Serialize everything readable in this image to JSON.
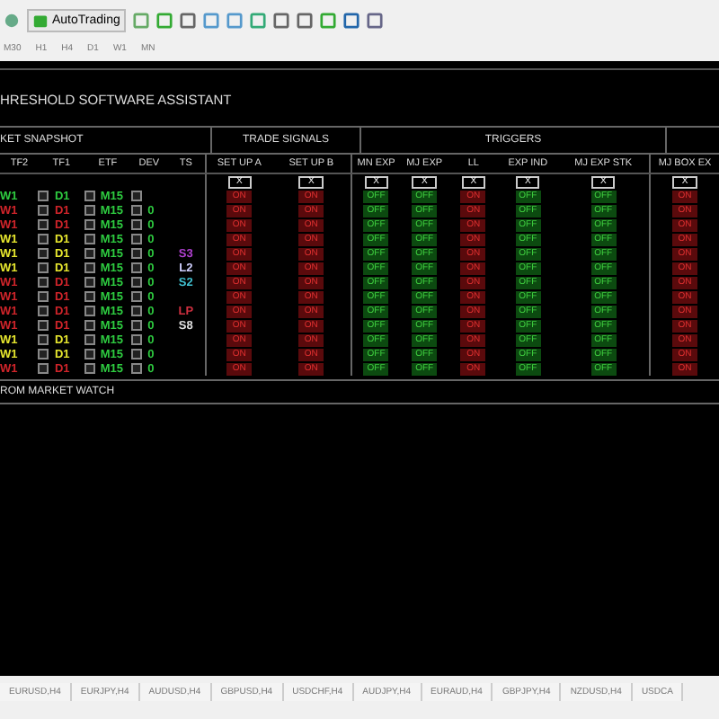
{
  "toolbar": {
    "autotrading": "AutoTrading",
    "timeframes": [
      "M30",
      "H1",
      "H4",
      "D1",
      "W1",
      "MN"
    ]
  },
  "panel": {
    "title": "HRESHOLD SOFTWARE ASSISTANT",
    "sections": [
      "KET SNAPSHOT",
      "TRADE SIGNALS",
      "TRIGGERS"
    ],
    "columns": [
      "TF2",
      "TF1",
      "ETF",
      "DEV",
      "TS",
      "SET UP A",
      "SET UP B",
      "MN EXP",
      "MJ EXP",
      "LL",
      "EXP IND",
      "MJ EXP STK",
      "MJ BOX EX"
    ],
    "close_buttons": [
      "X",
      "X",
      "X",
      "X",
      "X",
      "X",
      "X",
      "X"
    ],
    "rows": [
      {
        "tf2": {
          "text": "W1",
          "color": "#2ecc40"
        },
        "tf1": {
          "text": "D1",
          "color": "#2ecc40"
        },
        "etf": {
          "text": "M15",
          "color": "#2ecc40"
        },
        "signals": [
          {
            "label": "ON",
            "on": true
          },
          {
            "label": "ON",
            "on": true
          },
          {
            "label": "OFF",
            "on": false
          },
          {
            "label": "OFF",
            "on": false
          },
          {
            "label": "ON",
            "on": true
          },
          {
            "label": "OFF",
            "on": false
          },
          {
            "label": "OFF",
            "on": false
          },
          {
            "label": "ON",
            "on": true
          }
        ]
      },
      {
        "tf2": {
          "text": "W1",
          "color": "#d0242a"
        },
        "tf1": {
          "text": "D1",
          "color": "#d0242a"
        },
        "etf": {
          "text": "M15",
          "color": "#2ecc40"
        },
        "dev": "0",
        "signals": [
          {
            "label": "ON",
            "on": true
          },
          {
            "label": "ON",
            "on": true
          },
          {
            "label": "OFF",
            "on": false
          },
          {
            "label": "OFF",
            "on": false
          },
          {
            "label": "ON",
            "on": true
          },
          {
            "label": "OFF",
            "on": false
          },
          {
            "label": "OFF",
            "on": false
          },
          {
            "label": "ON",
            "on": true
          }
        ]
      },
      {
        "tf2": {
          "text": "W1",
          "color": "#d0242a"
        },
        "tf1": {
          "text": "D1",
          "color": "#d0242a"
        },
        "etf": {
          "text": "M15",
          "color": "#2ecc40"
        },
        "dev": "0",
        "signals": [
          {
            "label": "ON",
            "on": true
          },
          {
            "label": "ON",
            "on": true
          },
          {
            "label": "OFF",
            "on": false
          },
          {
            "label": "OFF",
            "on": false
          },
          {
            "label": "ON",
            "on": true
          },
          {
            "label": "OFF",
            "on": false
          },
          {
            "label": "OFF",
            "on": false
          },
          {
            "label": "ON",
            "on": true
          }
        ]
      },
      {
        "tf2": {
          "text": "W1",
          "color": "#e6e62e"
        },
        "tf1": {
          "text": "D1",
          "color": "#e6e62e"
        },
        "etf": {
          "text": "M15",
          "color": "#2ecc40"
        },
        "dev": "0",
        "signals": [
          {
            "label": "ON",
            "on": true
          },
          {
            "label": "ON",
            "on": true
          },
          {
            "label": "OFF",
            "on": false
          },
          {
            "label": "OFF",
            "on": false
          },
          {
            "label": "ON",
            "on": true
          },
          {
            "label": "OFF",
            "on": false
          },
          {
            "label": "OFF",
            "on": false
          },
          {
            "label": "ON",
            "on": true
          }
        ]
      },
      {
        "tf2": {
          "text": "W1",
          "color": "#e6e62e"
        },
        "tf1": {
          "text": "D1",
          "color": "#e6e62e"
        },
        "etf": {
          "text": "M15",
          "color": "#2ecc40"
        },
        "dev": "0",
        "ts": {
          "text": "S3",
          "color": "#b040d0"
        },
        "signals": [
          {
            "label": "ON",
            "on": true
          },
          {
            "label": "ON",
            "on": true
          },
          {
            "label": "OFF",
            "on": false
          },
          {
            "label": "OFF",
            "on": false
          },
          {
            "label": "ON",
            "on": true
          },
          {
            "label": "OFF",
            "on": false
          },
          {
            "label": "OFF",
            "on": false
          },
          {
            "label": "ON",
            "on": true
          }
        ]
      },
      {
        "tf2": {
          "text": "W1",
          "color": "#e6e62e"
        },
        "tf1": {
          "text": "D1",
          "color": "#e6e62e"
        },
        "etf": {
          "text": "M15",
          "color": "#2ecc40"
        },
        "dev": "0",
        "ts": {
          "text": "L2",
          "color": "#d0d0ff"
        },
        "signals": [
          {
            "label": "ON",
            "on": true
          },
          {
            "label": "ON",
            "on": true
          },
          {
            "label": "OFF",
            "on": false
          },
          {
            "label": "OFF",
            "on": false
          },
          {
            "label": "ON",
            "on": true
          },
          {
            "label": "OFF",
            "on": false
          },
          {
            "label": "OFF",
            "on": false
          },
          {
            "label": "ON",
            "on": true
          }
        ]
      },
      {
        "tf2": {
          "text": "W1",
          "color": "#d0242a"
        },
        "tf1": {
          "text": "D1",
          "color": "#d0242a"
        },
        "etf": {
          "text": "M15",
          "color": "#2ecc40"
        },
        "dev": "0",
        "ts": {
          "text": "S2",
          "color": "#40c0d0"
        },
        "signals": [
          {
            "label": "ON",
            "on": true
          },
          {
            "label": "ON",
            "on": true
          },
          {
            "label": "OFF",
            "on": false
          },
          {
            "label": "OFF",
            "on": false
          },
          {
            "label": "ON",
            "on": true
          },
          {
            "label": "OFF",
            "on": false
          },
          {
            "label": "OFF",
            "on": false
          },
          {
            "label": "ON",
            "on": true
          }
        ]
      },
      {
        "tf2": {
          "text": "W1",
          "color": "#d0242a"
        },
        "tf1": {
          "text": "D1",
          "color": "#d0242a"
        },
        "etf": {
          "text": "M15",
          "color": "#2ecc40"
        },
        "dev": "0",
        "signals": [
          {
            "label": "ON",
            "on": true
          },
          {
            "label": "ON",
            "on": true
          },
          {
            "label": "OFF",
            "on": false
          },
          {
            "label": "OFF",
            "on": false
          },
          {
            "label": "ON",
            "on": true
          },
          {
            "label": "OFF",
            "on": false
          },
          {
            "label": "OFF",
            "on": false
          },
          {
            "label": "ON",
            "on": true
          }
        ]
      },
      {
        "tf2": {
          "text": "W1",
          "color": "#d0242a"
        },
        "tf1": {
          "text": "D1",
          "color": "#d0242a"
        },
        "etf": {
          "text": "M15",
          "color": "#2ecc40"
        },
        "dev": "0",
        "ts": {
          "text": "LP",
          "color": "#d03040"
        },
        "signals": [
          {
            "label": "ON",
            "on": true
          },
          {
            "label": "ON",
            "on": true
          },
          {
            "label": "OFF",
            "on": false
          },
          {
            "label": "OFF",
            "on": false
          },
          {
            "label": "ON",
            "on": true
          },
          {
            "label": "OFF",
            "on": false
          },
          {
            "label": "OFF",
            "on": false
          },
          {
            "label": "ON",
            "on": true
          }
        ]
      },
      {
        "tf2": {
          "text": "W1",
          "color": "#d0242a"
        },
        "tf1": {
          "text": "D1",
          "color": "#d0242a"
        },
        "etf": {
          "text": "M15",
          "color": "#2ecc40"
        },
        "dev": "0",
        "ts": {
          "text": "S8",
          "color": "#e0e0e0"
        },
        "signals": [
          {
            "label": "ON",
            "on": true
          },
          {
            "label": "ON",
            "on": true
          },
          {
            "label": "OFF",
            "on": false
          },
          {
            "label": "OFF",
            "on": false
          },
          {
            "label": "ON",
            "on": true
          },
          {
            "label": "OFF",
            "on": false
          },
          {
            "label": "OFF",
            "on": false
          },
          {
            "label": "ON",
            "on": true
          }
        ]
      },
      {
        "tf2": {
          "text": "W1",
          "color": "#e6e62e"
        },
        "tf1": {
          "text": "D1",
          "color": "#e6e62e"
        },
        "etf": {
          "text": "M15",
          "color": "#2ecc40"
        },
        "dev": "0",
        "signals": [
          {
            "label": "ON",
            "on": true
          },
          {
            "label": "ON",
            "on": true
          },
          {
            "label": "OFF",
            "on": false
          },
          {
            "label": "OFF",
            "on": false
          },
          {
            "label": "ON",
            "on": true
          },
          {
            "label": "OFF",
            "on": false
          },
          {
            "label": "OFF",
            "on": false
          },
          {
            "label": "ON",
            "on": true
          }
        ]
      },
      {
        "tf2": {
          "text": "W1",
          "color": "#e6e62e"
        },
        "tf1": {
          "text": "D1",
          "color": "#e6e62e"
        },
        "etf": {
          "text": "M15",
          "color": "#2ecc40"
        },
        "dev": "0",
        "signals": [
          {
            "label": "ON",
            "on": true
          },
          {
            "label": "ON",
            "on": true
          },
          {
            "label": "OFF",
            "on": false
          },
          {
            "label": "OFF",
            "on": false
          },
          {
            "label": "ON",
            "on": true
          },
          {
            "label": "OFF",
            "on": false
          },
          {
            "label": "OFF",
            "on": false
          },
          {
            "label": "ON",
            "on": true
          }
        ]
      },
      {
        "tf2": {
          "text": "W1",
          "color": "#d0242a"
        },
        "tf1": {
          "text": "D1",
          "color": "#d0242a"
        },
        "etf": {
          "text": "M15",
          "color": "#2ecc40"
        },
        "dev": "0",
        "signals": [
          {
            "label": "ON",
            "on": true
          },
          {
            "label": "ON",
            "on": true
          },
          {
            "label": "OFF",
            "on": false
          },
          {
            "label": "OFF",
            "on": false
          },
          {
            "label": "ON",
            "on": true
          },
          {
            "label": "OFF",
            "on": false
          },
          {
            "label": "OFF",
            "on": false
          },
          {
            "label": "ON",
            "on": true
          }
        ]
      }
    ],
    "footer": "ROM MARKET WATCH"
  },
  "chart_tabs": [
    "EURUSD,H4",
    "EURJPY,H4",
    "AUDUSD,H4",
    "GBPUSD,H4",
    "USDCHF,H4",
    "AUDJPY,H4",
    "EURAUD,H4",
    "GBPJPY,H4",
    "NZDUSD,H4",
    "USDCA"
  ]
}
